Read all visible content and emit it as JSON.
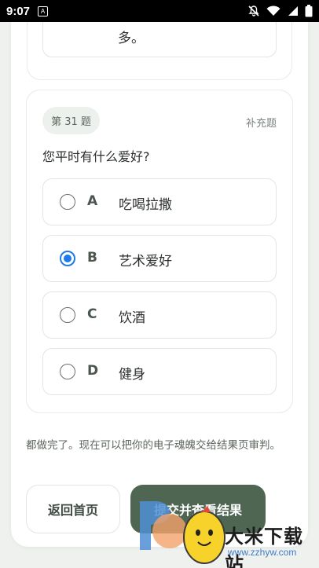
{
  "status_bar": {
    "time": "9:07",
    "app_icon": "A"
  },
  "previous_question": {
    "answer_tail": "多。"
  },
  "question": {
    "number_label": "第 31 题",
    "tag": "补充题",
    "text": "您平时有什么爱好?",
    "selected_letter": "B",
    "options": [
      {
        "letter": "A",
        "label": "吃喝拉撒",
        "selected": false
      },
      {
        "letter": "B",
        "label": "艺术爱好",
        "selected": true
      },
      {
        "letter": "C",
        "label": "饮酒",
        "selected": false
      },
      {
        "letter": "D",
        "label": "健身",
        "selected": false
      }
    ]
  },
  "footer": {
    "done_text": "都做完了。现在可以把你的电子魂魄交给结果页审判。",
    "home_button": "返回首页",
    "submit_button": "提交并查看结果"
  },
  "watermark": {
    "brand": "大米下载站",
    "url": "www.zzhyw.com"
  },
  "colors": {
    "accent_green": "#4f6653",
    "radio_selected": "#1f7ae8",
    "background": "#eef1ee"
  }
}
